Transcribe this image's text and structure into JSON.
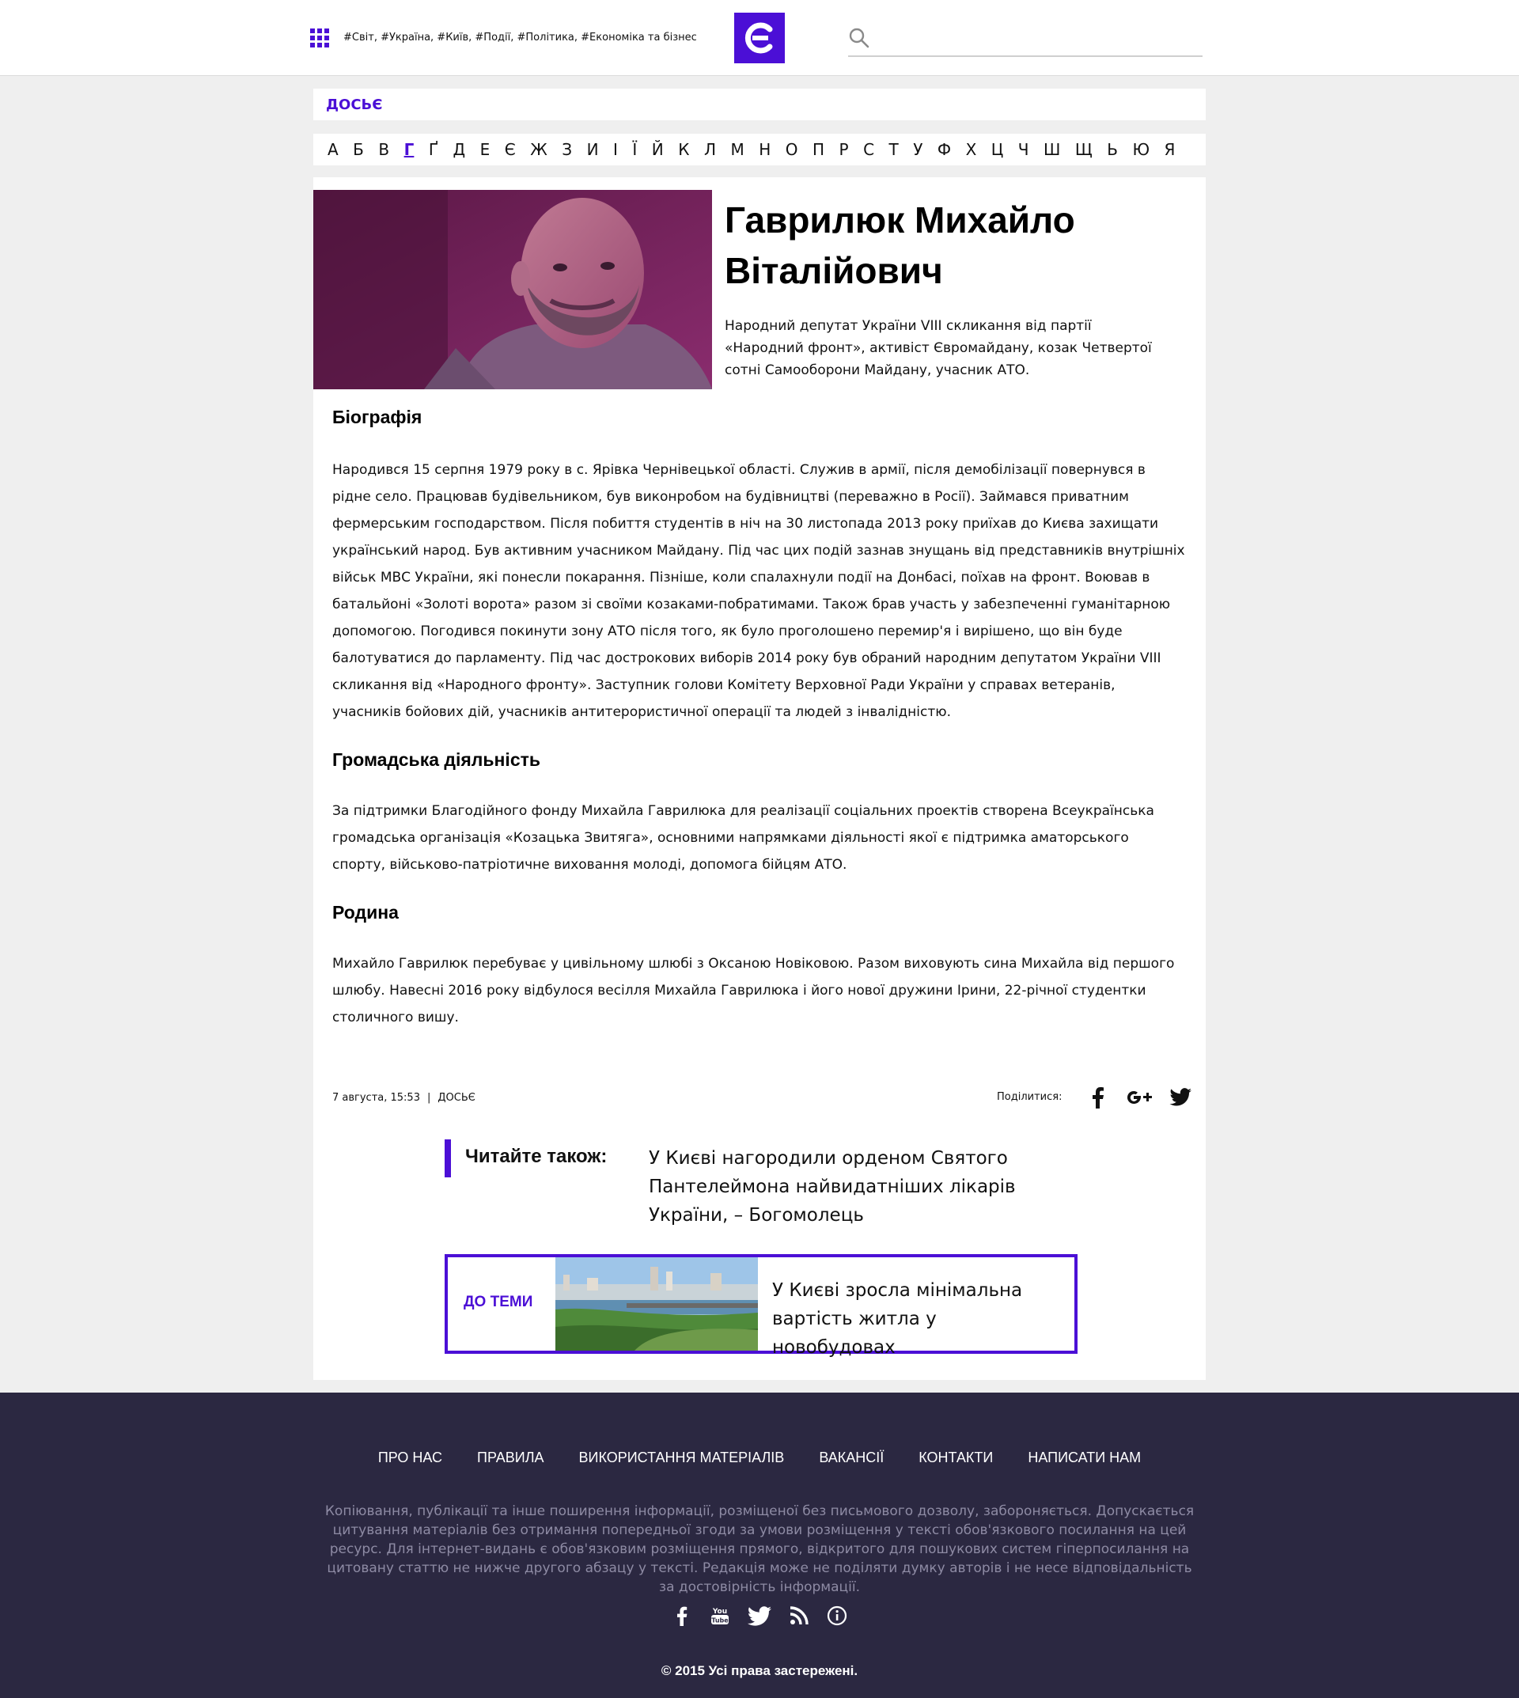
{
  "header": {
    "tags": "#Світ, #Україна, #Київ, #Події, #Політика, #Економіка та бізнес",
    "logo_letter": "Є",
    "search_placeholder": ""
  },
  "section": {
    "label": "ДОСЬЄ"
  },
  "alphabet": {
    "active": "Г",
    "letters": [
      "А",
      "Б",
      "В",
      "Г",
      "Ґ",
      "Д",
      "Е",
      "Є",
      "Ж",
      "З",
      "И",
      "І",
      "Ї",
      "Й",
      "К",
      "Л",
      "М",
      "Н",
      "О",
      "П",
      "Р",
      "С",
      "Т",
      "У",
      "Ф",
      "Х",
      "Ц",
      "Ч",
      "Ш",
      "Щ",
      "Ь",
      "Ю",
      "Я"
    ]
  },
  "article": {
    "title": "Гаврилюк Михайло Віталійович",
    "lead": "Народний депутат України VIII скликання від партії «Народний фронт», активіст Євромайдану, козак Четвертої сотні Самооборони Майдану, учасник АТО.",
    "sections": [
      {
        "heading": "Біографія",
        "text": "Народився 15 серпня 1979 року в с. Ярівка Чернівецької області. Служив в армії, після демобілізації повернувся в рідне село. Працював будівельником, був виконробом на будівництві (переважно в Росії). Займався приватним фермерським господарством. Після побиття студентів в ніч на 30 листопада 2013 року приїхав до Києва захищати український народ. Був активним учасником Майдану. Під час цих подій зазнав знущань від представників внутрішніх військ МВС України, які понесли покарання. Пізніше, коли  спалахнули події на Донбасі, поїхав на фронт. Воював в батальйоні «Золоті ворота» разом зі своїми козаками-побратимами. Також брав участь у забезпеченні гуманітарною допомогою. Погодився покинути зону АТО після того, як було проголошено перемир'я і вирішено, що він буде балотуватися до парламенту. Під час дострокових виборів 2014 року був обраний народним депутатом України VIII скликання від «Народного фронту». Заступник голови Комітету Верховної Ради України у справах ветеранів, учасників бойових дій, учасників антитерористичної операції та людей з інвалідністю."
      },
      {
        "heading": "Громадська діяльність",
        "text": "За підтримки Благодійного фонду Михайла Гаврилюка для реалізації соціальних проектів створена Всеукраїнська громадська організація «Козацька Звитяга», основними напрямками діяльності якої є підтримка аматорського спорту, військово-патріотичне виховання молоді, допомога бійцям АТО."
      },
      {
        "heading": "Родина",
        "text": "Михайло Гаврилюк перебуває у цивільному шлюбі з Оксаною Новіковою. Разом виховують сина Михайла від першого шлюбу.  Навесні 2016 року відбулося весілля Михайла Гаврилюка і його нової дружини Ірини, 22-річної студентки столичного вишу."
      }
    ],
    "date": "7 августа, 15:53",
    "separator": "|",
    "category": "ДОСЬЄ",
    "share_label": "Поділитися:",
    "share_icons": [
      "facebook-icon",
      "google-plus-icon",
      "twitter-icon"
    ]
  },
  "read_also": {
    "label": "Читайте також:",
    "link": "У Києві нагородили орденом Святого Пантелеймона найвидатніших лікарів України, – Богомолець"
  },
  "topic": {
    "label": "ДО ТЕМИ",
    "link": "У Києві зросла мінімальна вартість житла у новобудовах"
  },
  "footer": {
    "nav": [
      "ПРО НАС",
      "ПРАВИЛА",
      "ВИКОРИСТАННЯ МАТЕРІАЛІВ",
      "ВАКАНСІЇ",
      "КОНТАКТИ",
      "НАПИСАТИ НАМ"
    ],
    "note": "Копіювання, публікації та інше поширення інформації, розміщеної без письмового дозволу, забороняється. Допускається цитування матеріалів без отримання попередньої згоди за умови розміщення у тексті обов'язкового посилання на цей ресурс. Для інтернет-видань є обов'язковим розміщення прямого, відкритого для пошукових систем гіперпосилання на цитовану статтю не нижче другого абзацу у тексті. Редакція може не поділяти думку авторів і не несе відповідальність за достовірність інформації.",
    "social": [
      "facebook-icon",
      "youtube-icon",
      "twitter-icon",
      "rss-icon",
      "info-icon"
    ],
    "copyright": "© 2015 Усі права застережені."
  },
  "colors": {
    "accent": "#4b0fd6",
    "footer_bg": "#2b2841",
    "page_bg": "#efefef"
  }
}
